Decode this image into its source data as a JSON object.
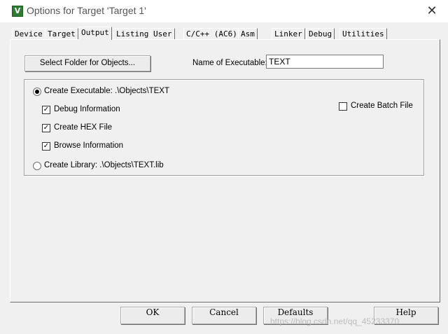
{
  "window": {
    "title": "Options for Target 'Target 1'",
    "app_icon_letter": "V",
    "close_glyph": "✕"
  },
  "tabs": [
    {
      "label": "Device",
      "active": false
    },
    {
      "label": "Target",
      "active": false
    },
    {
      "label": "Output",
      "active": true
    },
    {
      "label": "Listing",
      "active": false
    },
    {
      "label": "User",
      "active": false
    },
    {
      "label": "C/C++ (AC6)",
      "active": false
    },
    {
      "label": "Asm",
      "active": false
    },
    {
      "label": "Linker",
      "active": false
    },
    {
      "label": "Debug",
      "active": false
    },
    {
      "label": "Utilities",
      "active": false
    }
  ],
  "output": {
    "select_folder_label": "Select Folder for Objects...",
    "name_label": "Name of Executable:",
    "name_value": "TEXT",
    "create_executable_label": "Create Executable:  .\\Objects\\TEXT",
    "create_executable_selected": true,
    "debug_info_label": "Debug Information",
    "debug_info_checked": true,
    "create_hex_label": "Create HEX File",
    "create_hex_checked": true,
    "browse_info_label": "Browse Information",
    "browse_info_checked": true,
    "create_library_label": "Create Library:  .\\Objects\\TEXT.lib",
    "create_library_selected": false,
    "create_batch_label": "Create Batch File",
    "create_batch_checked": false
  },
  "footer": {
    "ok_label": "OK",
    "cancel_label": "Cancel",
    "defaults_label": "Defaults",
    "help_label": "Help",
    "watermark": "https://blog.csdn.net/qq_45233370"
  }
}
